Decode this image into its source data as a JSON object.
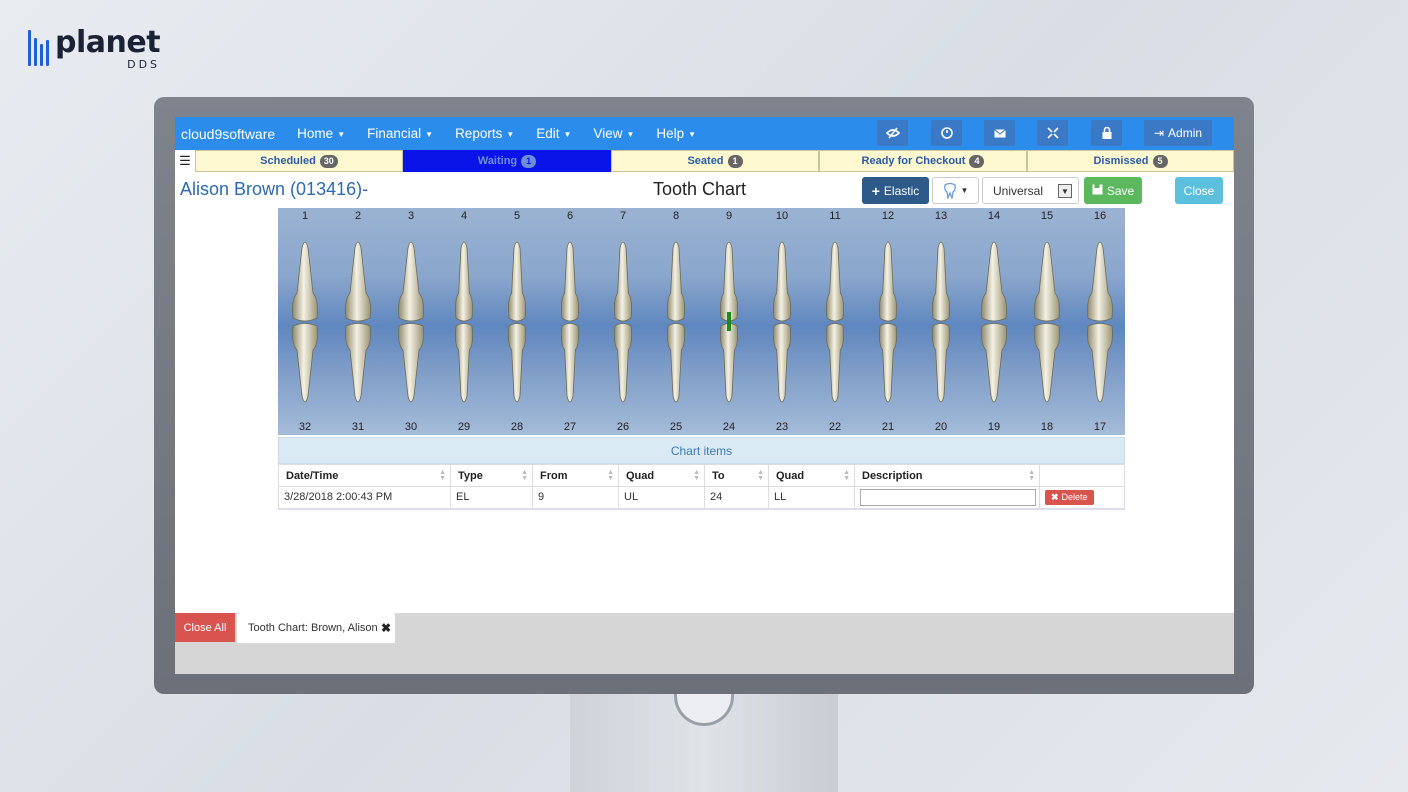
{
  "logo": {
    "word": "planet",
    "sub": "DDS"
  },
  "navbar": {
    "brand": "cloud9software",
    "menus": [
      "Home",
      "Financial",
      "Reports",
      "Edit",
      "View",
      "Help"
    ],
    "admin_label": "Admin",
    "icons": [
      "eye-slash-icon",
      "clock-icon",
      "envelope-icon",
      "expand-icon",
      "lock-icon"
    ]
  },
  "statusbar": {
    "tabs": [
      {
        "label": "Scheduled",
        "count": "30"
      },
      {
        "label": "Waiting",
        "count": "1"
      },
      {
        "label": "Seated",
        "count": "1"
      },
      {
        "label": "Ready for Checkout",
        "count": "4"
      },
      {
        "label": "Dismissed",
        "count": "5"
      }
    ],
    "active_tab": "Waiting"
  },
  "header": {
    "patient": "Alison Brown (013416)-",
    "page_title": "Tooth Chart",
    "elastic_label": "Elastic",
    "numbering_value": "Universal",
    "save_label": "Save",
    "close_label": "Close"
  },
  "tooth_chart": {
    "upper_numbers": [
      "1",
      "2",
      "3",
      "4",
      "5",
      "6",
      "7",
      "8",
      "9",
      "10",
      "11",
      "12",
      "13",
      "14",
      "15",
      "16"
    ],
    "lower_numbers": [
      "32",
      "31",
      "30",
      "29",
      "28",
      "27",
      "26",
      "25",
      "24",
      "23",
      "22",
      "21",
      "20",
      "19",
      "18",
      "17"
    ],
    "marker_tooth": "9"
  },
  "chart_items": {
    "title": "Chart items",
    "columns": [
      "Date/Time",
      "Type",
      "From",
      "Quad",
      "To",
      "Quad",
      "Description",
      ""
    ],
    "rows": [
      {
        "datetime": "3/28/2018 2:00:43 PM",
        "type": "EL",
        "from": "9",
        "from_quad": "UL",
        "to": "24",
        "to_quad": "LL",
        "description": "",
        "action": "Delete"
      }
    ]
  },
  "bottom_bar": {
    "close_all": "Close All",
    "open_tab": "Tooth Chart: Brown, Alison"
  },
  "colors": {
    "navbar": "#2b8cec",
    "status_active": "#0a14e8",
    "save": "#5cb85c",
    "close": "#5bc0de",
    "delete": "#d9534f"
  }
}
